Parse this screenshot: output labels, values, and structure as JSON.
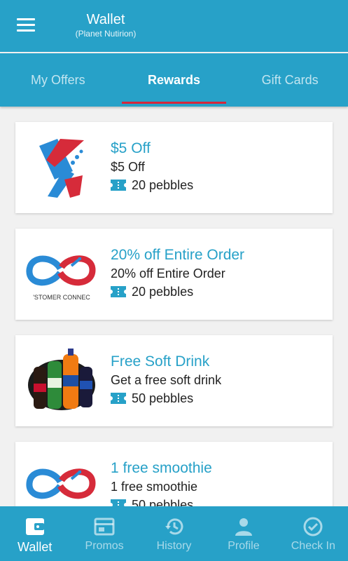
{
  "header": {
    "title": "Wallet",
    "subtitle": "(Planet Nutirion)"
  },
  "tabs": [
    {
      "label": "My Offers",
      "active": false
    },
    {
      "label": "Rewards",
      "active": true
    },
    {
      "label": "Gift Cards",
      "active": false
    }
  ],
  "offers": [
    {
      "title": "$5 Off",
      "description": "$5 Off",
      "cost": "20 pebbles",
      "image": "brand-logo-x-icon"
    },
    {
      "title": "20% off Entire Order",
      "description": "20% off Entire Order",
      "cost": "20 pebbles",
      "image": "customer-connect-logo",
      "image_text": "'STOMER CONNEC"
    },
    {
      "title": "Free Soft Drink",
      "description": "Get a free soft drink",
      "cost": "50 pebbles",
      "image": "soft-drink-bottles-image"
    },
    {
      "title": "1 free smoothie",
      "description": "1 free smoothie",
      "cost": "50 pebbles",
      "image": "customer-connect-logo"
    }
  ],
  "bottom_nav": [
    {
      "label": "Wallet",
      "icon": "wallet-icon",
      "active": true
    },
    {
      "label": "Promos",
      "icon": "promos-icon",
      "active": false
    },
    {
      "label": "History",
      "icon": "history-icon",
      "active": false
    },
    {
      "label": "Profile",
      "icon": "profile-icon",
      "active": false
    },
    {
      "label": "Check In",
      "icon": "check-in-icon",
      "active": false
    }
  ],
  "colors": {
    "primary": "#27a1c8",
    "accent": "#d6253a",
    "card_bg": "#ffffff",
    "page_bg": "#f1f1f1"
  }
}
